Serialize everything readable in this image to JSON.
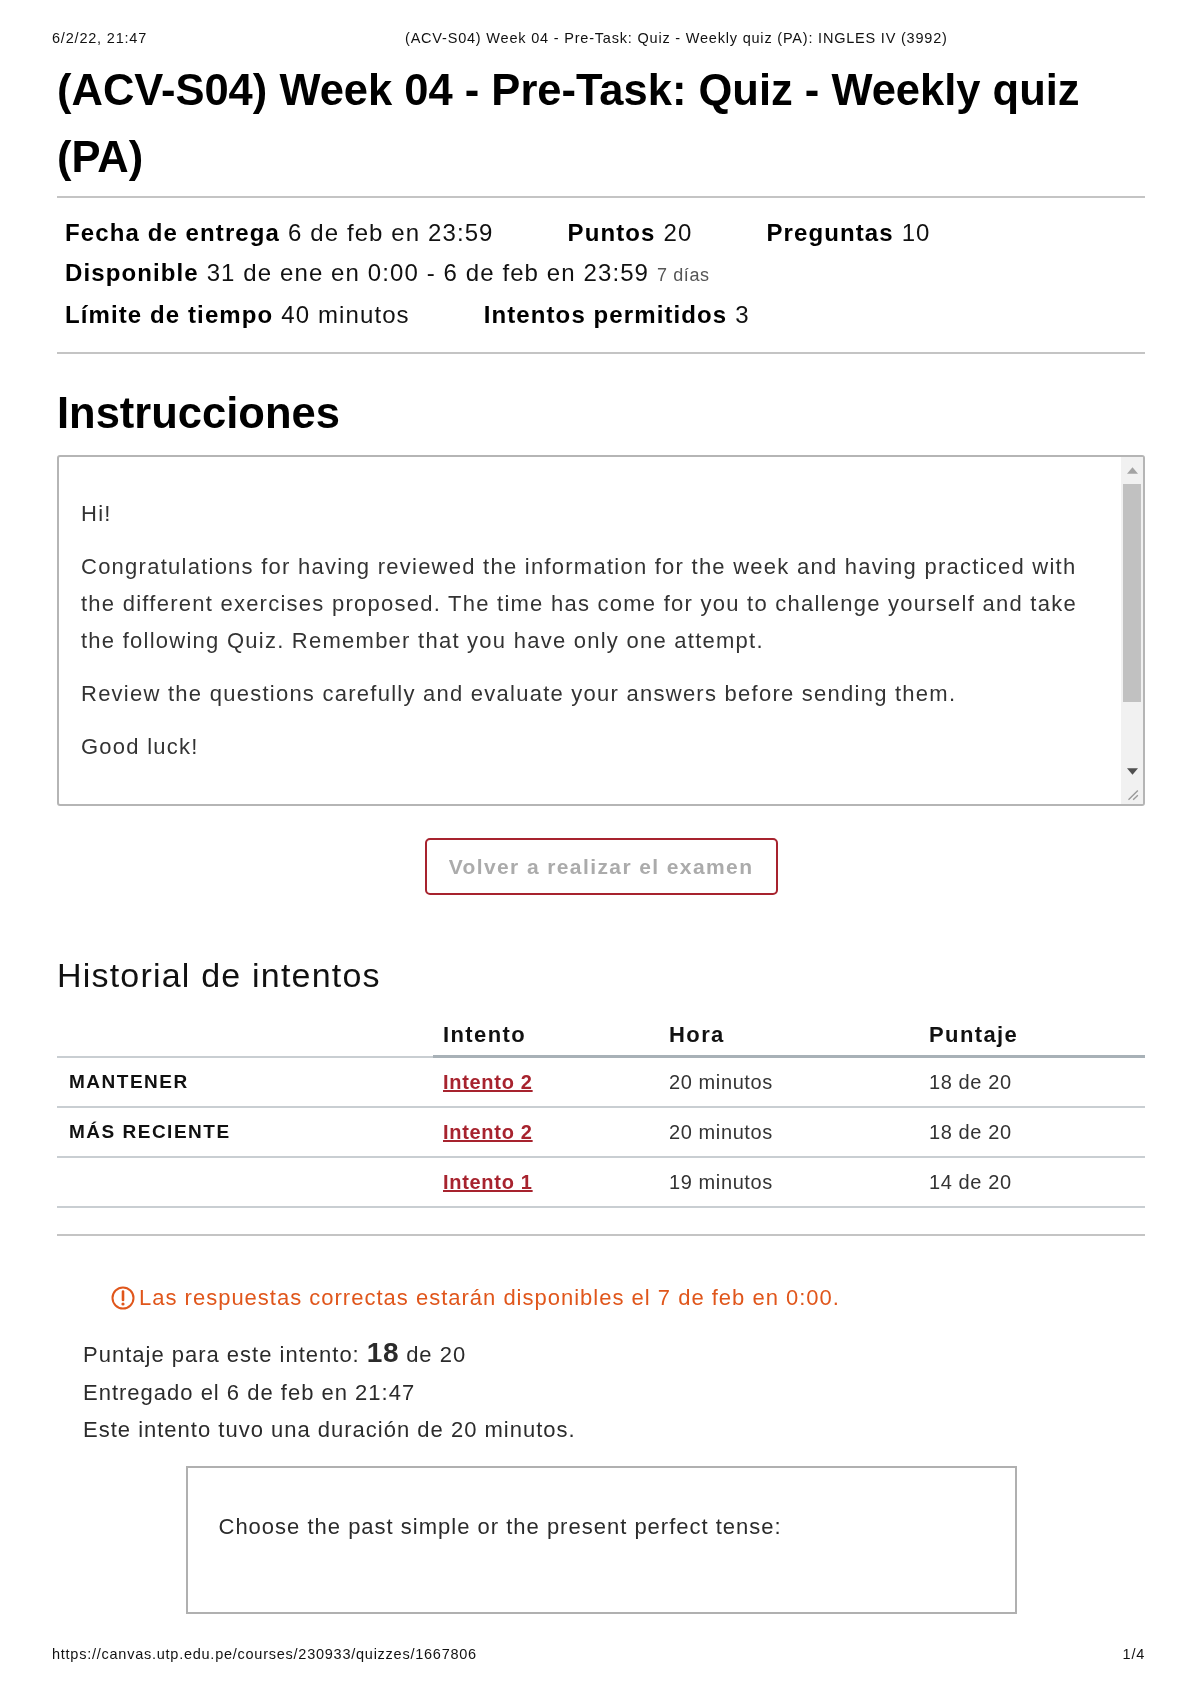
{
  "print_header": {
    "date": "6/2/22, 21:47",
    "title": "(ACV-S04) Week 04 - Pre-Task: Quiz - Weekly quiz (PA): INGLES IV (3992)"
  },
  "quiz": {
    "title": "(ACV-S04) Week 04 - Pre-Task: Quiz - Weekly quiz (PA)",
    "details": [
      [
        {
          "label": "Fecha de entrega",
          "value": "6 de feb en 23:59"
        },
        {
          "label": "Puntos",
          "value": "20"
        },
        {
          "label": "Preguntas",
          "value": "10"
        }
      ],
      [
        {
          "label": "Disponible",
          "value": "31 de ene en 0:00 - 6 de feb en 23:59",
          "note": "7 días"
        }
      ],
      [
        {
          "label": "Límite de tiempo",
          "value": "40 minutos"
        },
        {
          "label": "Intentos permitidos",
          "value": "3"
        }
      ]
    ]
  },
  "instructions": {
    "heading": "Instrucciones",
    "paragraphs": [
      "Hi!",
      "Congratulations for having reviewed the information for the week and having practiced with the different exercises proposed. The time has come for you to challenge yourself and take the following Quiz. Remember that you have only one attempt.",
      "Review the questions carefully and evaluate your answers before sending them.",
      "Good luck!"
    ]
  },
  "retake_button": {
    "label": "Volver a realizar el examen",
    "disabled": true
  },
  "history": {
    "heading": "Historial de intentos",
    "columns": [
      "Intento",
      "Hora",
      "Puntaje"
    ],
    "rows": [
      {
        "tag": "MANTENER",
        "attempt": "Intento 2",
        "time": "20 minutos",
        "score": "18 de 20"
      },
      {
        "tag": "MÁS RECIENTE",
        "attempt": "Intento 2",
        "time": "20 minutos",
        "score": "18 de 20"
      },
      {
        "attempt": "Intento 1",
        "time": "19 minutos",
        "score": "14 de 20"
      }
    ]
  },
  "notice": {
    "text": "Las respuestas correctas estarán disponibles el 7 de feb en 0:00."
  },
  "result": {
    "score_line": "Puntaje para este intento: **18** de 20",
    "submitted": "Entregado el 6 de feb en 21:47",
    "duration": "Este intento tuvo una duración de 20 minutos."
  },
  "question": {
    "text": "Choose the past simple or the present perfect tense:"
  },
  "print_footer": {
    "url": "https://canvas.utp.edu.pe/courses/230933/quizzes/1667806",
    "page": "1/4"
  }
}
